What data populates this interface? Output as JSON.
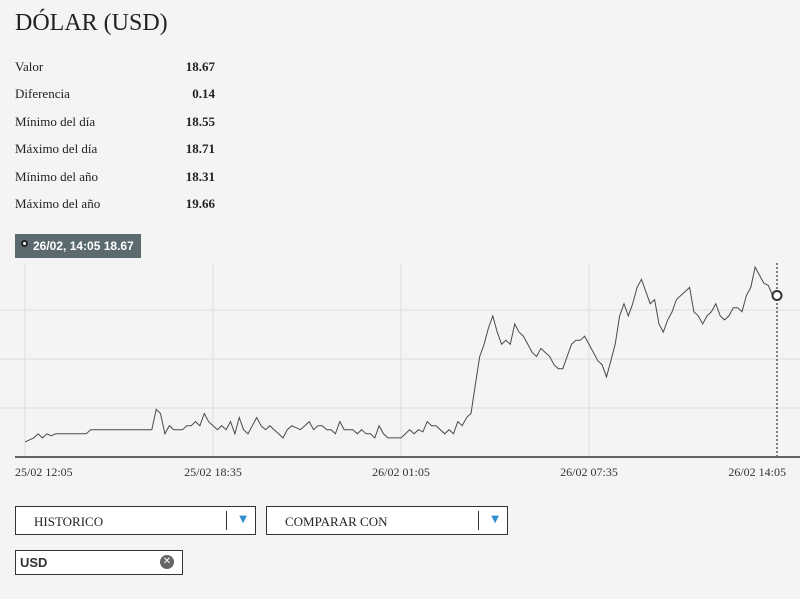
{
  "title": "DÓLAR (USD)",
  "stats": [
    {
      "label": "Valor",
      "value": "18.67"
    },
    {
      "label": "Diferencia",
      "value": "0.14"
    },
    {
      "label": "Mínimo del día",
      "value": "18.55"
    },
    {
      "label": "Máximo del día",
      "value": "18.71"
    },
    {
      "label": "Mínimo del año",
      "value": "18.31"
    },
    {
      "label": "Máximo del año",
      "value": "19.66"
    }
  ],
  "tooltip": {
    "text": "26/02, 14:05 18.67"
  },
  "controls": {
    "historico_label": "HISTORICO",
    "comparar_label": "COMPARAR CON",
    "tag_label": "USD"
  },
  "chart_data": {
    "type": "line",
    "title": "",
    "xlabel": "",
    "ylabel": "",
    "x_tick_labels": [
      "25/02 12:05",
      "25/02 18:35",
      "26/02 01:05",
      "26/02 07:35",
      "26/02 14:05"
    ],
    "ylim": [
      18.3,
      18.75
    ],
    "grid": true,
    "line_color": "#4a4a4a",
    "series": [
      {
        "values": [
          18.31,
          18.315,
          18.32,
          18.33,
          18.32,
          18.33,
          18.325,
          18.33,
          18.33,
          18.33,
          18.33,
          18.33,
          18.33,
          18.33,
          18.33,
          18.34,
          18.34,
          18.34,
          18.34,
          18.34,
          18.34,
          18.34,
          18.34,
          18.34,
          18.34,
          18.34,
          18.34,
          18.34,
          18.34,
          18.34,
          18.39,
          18.38,
          18.33,
          18.35,
          18.34,
          18.34,
          18.34,
          18.35,
          18.35,
          18.36,
          18.35,
          18.38,
          18.36,
          18.35,
          18.34,
          18.35,
          18.34,
          18.36,
          18.33,
          18.37,
          18.34,
          18.33,
          18.35,
          18.37,
          18.35,
          18.34,
          18.35,
          18.34,
          18.33,
          18.32,
          18.34,
          18.35,
          18.345,
          18.34,
          18.35,
          18.36,
          18.34,
          18.35,
          18.35,
          18.34,
          18.34,
          18.33,
          18.36,
          18.34,
          18.34,
          18.34,
          18.33,
          18.34,
          18.33,
          18.33,
          18.32,
          18.35,
          18.33,
          18.32,
          18.32,
          18.32,
          18.32,
          18.33,
          18.34,
          18.33,
          18.34,
          18.335,
          18.36,
          18.35,
          18.35,
          18.34,
          18.33,
          18.34,
          18.33,
          18.36,
          18.35,
          18.37,
          18.38,
          18.45,
          18.52,
          18.55,
          18.59,
          18.62,
          18.58,
          18.55,
          18.56,
          18.55,
          18.6,
          18.58,
          18.57,
          18.55,
          18.53,
          18.52,
          18.54,
          18.53,
          18.52,
          18.5,
          18.49,
          18.49,
          18.52,
          18.55,
          18.56,
          18.56,
          18.57,
          18.55,
          18.53,
          18.51,
          18.5,
          18.47,
          18.51,
          18.55,
          18.62,
          18.65,
          18.62,
          18.65,
          18.69,
          18.71,
          18.68,
          18.65,
          18.66,
          18.6,
          18.58,
          18.61,
          18.63,
          18.66,
          18.67,
          18.68,
          18.69,
          18.63,
          18.62,
          18.6,
          18.62,
          18.63,
          18.65,
          18.62,
          18.61,
          18.62,
          18.64,
          18.64,
          18.63,
          18.67,
          18.69,
          18.74,
          18.72,
          18.7,
          18.695,
          18.67,
          18.67
        ]
      }
    ]
  }
}
